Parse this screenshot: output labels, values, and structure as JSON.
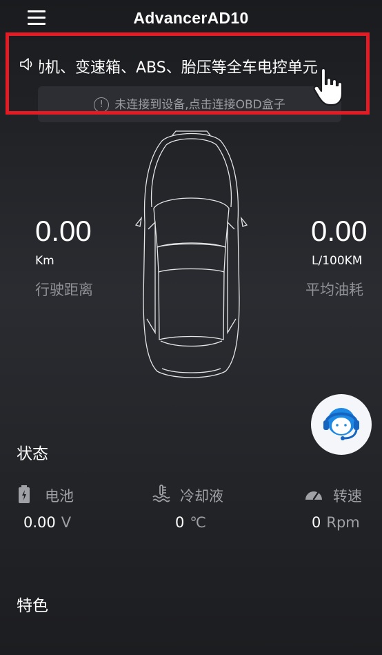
{
  "header": {
    "title": "AdvancerAD10"
  },
  "marquee": {
    "text": "动机、变速箱、ABS、胎压等全车电控单元"
  },
  "banner": {
    "icon": "!",
    "text": "未连接到设备,点击连接OBD盒子"
  },
  "stats": {
    "distance": {
      "value": "0.00",
      "unit": "Km",
      "label": "行驶距离"
    },
    "fuel": {
      "value": "0.00",
      "unit": "L/100KM",
      "label": "平均油耗"
    }
  },
  "status": {
    "title": "状态",
    "battery": {
      "label": "电池",
      "value": "0.00",
      "unit": "V"
    },
    "coolant": {
      "label": "冷却液",
      "value": "0",
      "unit": "℃"
    },
    "rpm": {
      "label": "转速",
      "value": "0",
      "unit": "Rpm"
    }
  },
  "features": {
    "title": "特色"
  },
  "colors": {
    "highlight_border": "#e21b24",
    "support_blue": "#1e88e5"
  }
}
